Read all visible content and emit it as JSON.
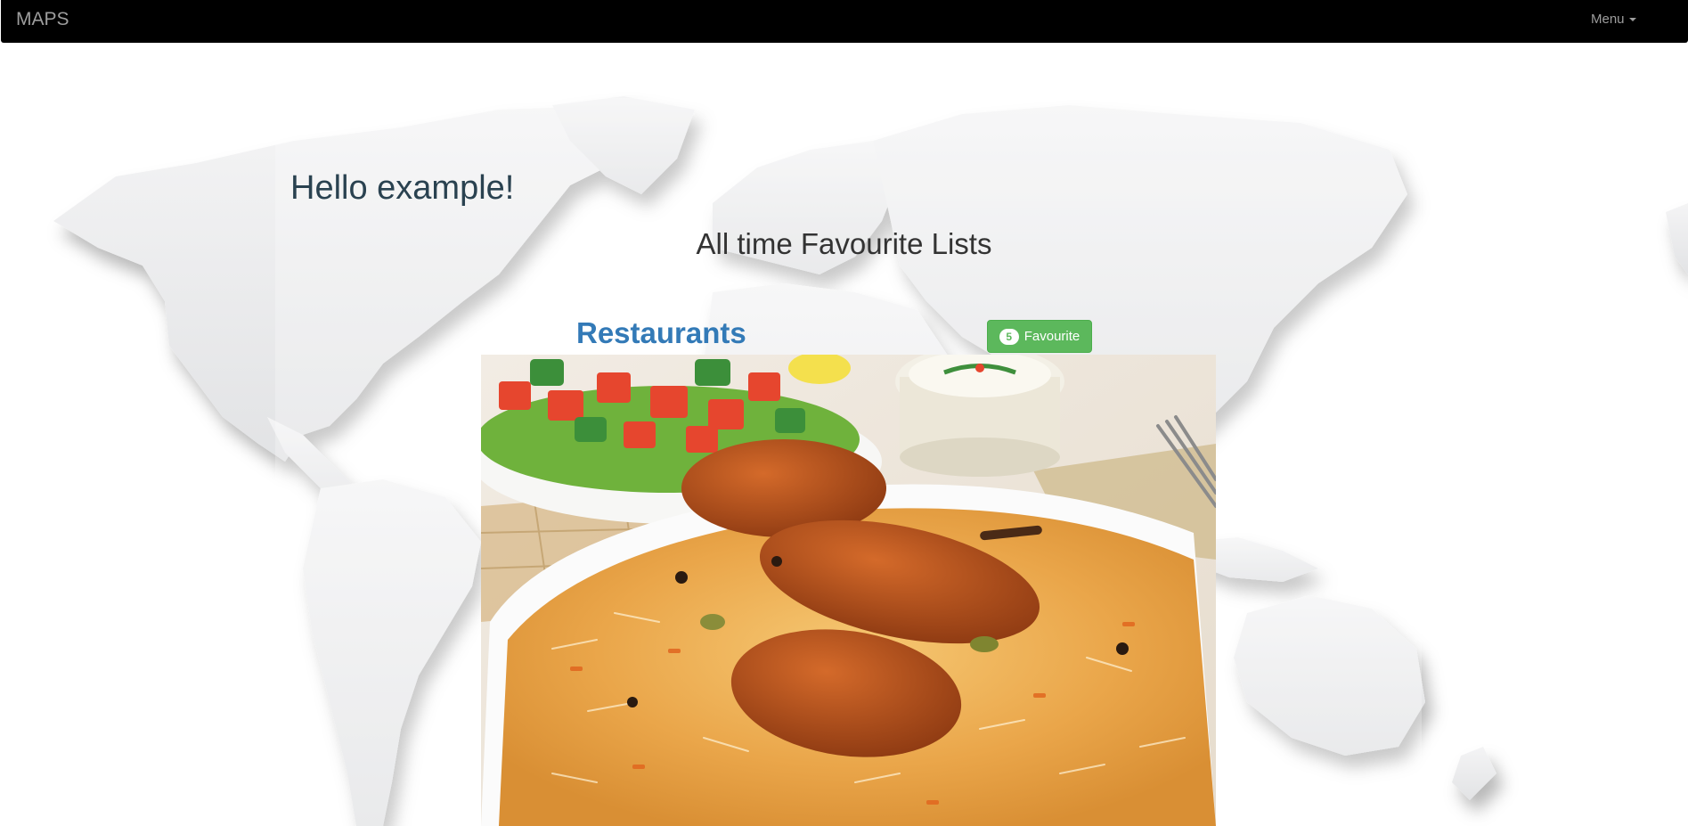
{
  "navbar": {
    "brand": "MAPS",
    "menu_label": "Menu"
  },
  "main": {
    "greeting": "Hello example!",
    "section_title": "All time Favourite Lists",
    "lists": [
      {
        "title": "Restaurants",
        "favourite_count": "5",
        "favourite_label": "Favourite"
      }
    ]
  },
  "colors": {
    "navbar_bg": "#000000",
    "link_blue": "#337ab7",
    "success_green": "#5cb85c"
  },
  "icons": {
    "menu_caret": "caret-down-icon"
  }
}
